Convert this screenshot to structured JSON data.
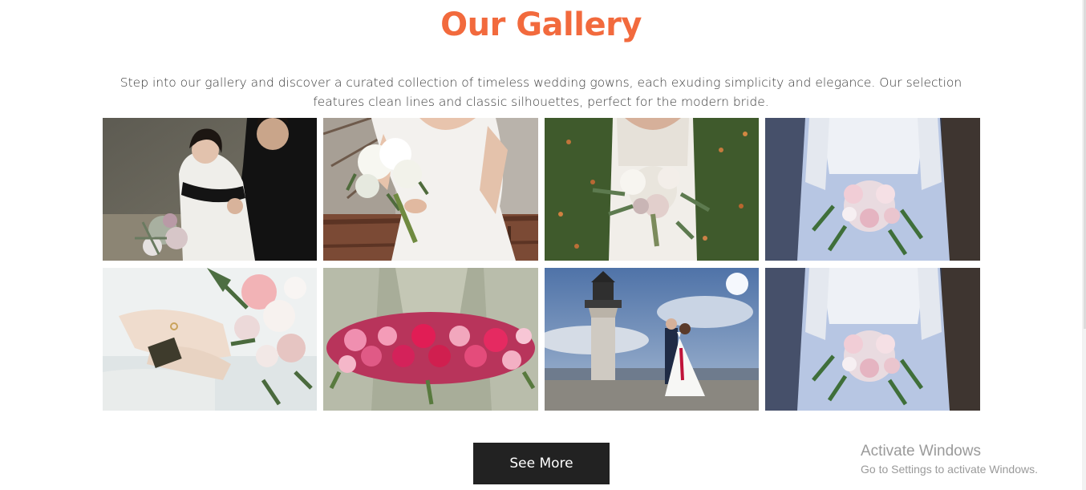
{
  "gallery": {
    "title": "Our Gallery",
    "intro": "Step into our gallery and discover a curated collection of timeless wedding gowns, each exuding simplicity and elegance. Our selection features clean lines and classic silhouettes, perfect for the modern bride.",
    "see_more_label": "See More"
  },
  "watermark": {
    "title": "Activate Windows",
    "subtitle": "Go to Settings to activate Windows."
  },
  "colors": {
    "accent": "#f26a3d",
    "button_bg": "#222222",
    "text": "#3a3a3a"
  }
}
